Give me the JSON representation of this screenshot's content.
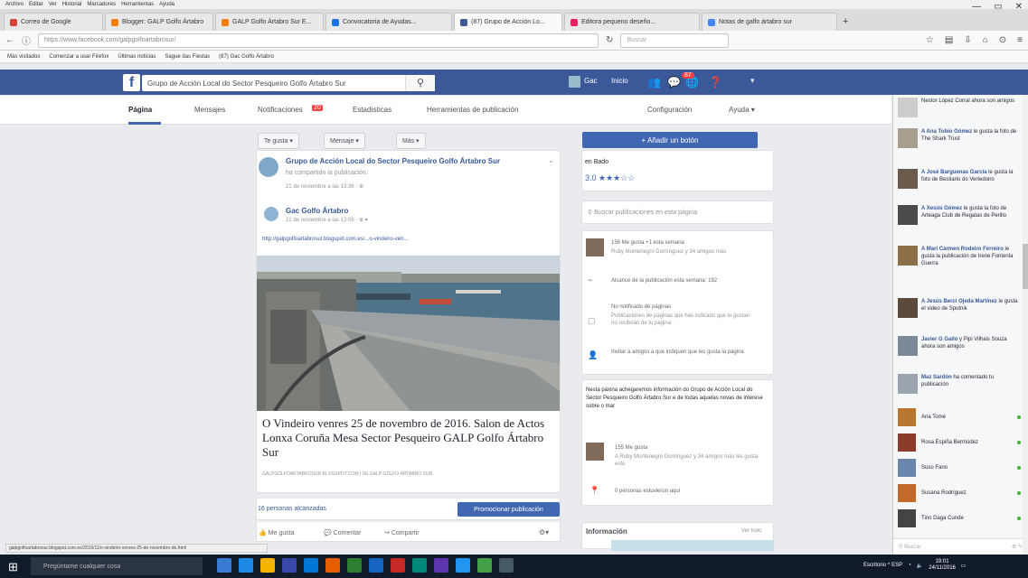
{
  "browser": {
    "menu": [
      "Archivo",
      "Editar",
      "Ver",
      "Historial",
      "Marcadores",
      "Herramientas",
      "Ayuda"
    ],
    "tabs": [
      {
        "label": "Correo de Google",
        "color": "#d44638",
        "active": false
      },
      {
        "label": "Blogger: GALP Golfo Ártabro",
        "color": "#f57d00",
        "active": false
      },
      {
        "label": "GALP Golfo Ártabro Sur E...",
        "color": "#f57d00",
        "active": false
      },
      {
        "label": "Convocatoria de Ayudas...",
        "color": "#1a73e8",
        "active": false
      },
      {
        "label": "(87) Grupo de Acción Lo...",
        "color": "#3b5998",
        "active": true
      },
      {
        "label": "Editora pequeno deseño...",
        "color": "#e91e63",
        "active": false
      },
      {
        "label": "Notas de galfo ártabro sur",
        "color": "#4285f4",
        "active": false
      }
    ],
    "url": "https://www.facebook.com/galpgolfoartabrosur/",
    "search_placeholder": "Buscar",
    "bookmarks": [
      "Más visitados",
      "Comenzar a usar Firefox",
      "Últimas noticias",
      "Sague das Fiestas",
      "(87) Gac Golfo Ártabro"
    ],
    "window_controls": [
      "—",
      "▭",
      "✕"
    ]
  },
  "facebook": {
    "logo": "f",
    "search_value": "Grupo de Acción Local do Sector Pesqueiro Golfo Ártabro Sur",
    "user_name": "Gac",
    "nav_home": "Inicio",
    "notification_count": "87",
    "page_tabs": [
      {
        "label": "Página",
        "active": true
      },
      {
        "label": "Mensajes",
        "active": false
      },
      {
        "label": "Notificaciones",
        "active": false
      },
      {
        "label": "Estadísticas",
        "active": false
      },
      {
        "label": "Herramientas de publicación",
        "active": false
      }
    ],
    "notifications_badge": "20",
    "settings_label": "Configuración",
    "help_label": "Ayuda ▾",
    "action_buttons": [
      "Te gusta ▾",
      "Mensaje ▾",
      "Más ▾"
    ],
    "add_button_label": "+ Añadir un botón"
  },
  "post": {
    "page_name": "Grupo de Acción Local do Sector Pesqueiro Golfo Ártabro Sur",
    "shared_text": "ha compartido la publicación.",
    "shared_time": "21 de noviembre a las 13:36 · ⊕",
    "inner_author": "Gac Golfo Ártabro",
    "inner_time": "21 de noviembre a las 13:08 · ⊕ ▾",
    "link_text": "http://galpgolfoartabrosur.blogspot.com.es/...o-vindeiro-ven...",
    "link_title": "O Vindeiro venres 25 de novembro de 2016. Salon de Actos Lonxa Coruña Mesa Sector Pesqueiro GALP Golfo Ártabro Sur",
    "link_domain": "GALPGOLFOARTABROSUR.BLOGSPOT.COM | DE GALP GOLFO ÁRTABRO SUR",
    "reach": "16 personas alcanzadas",
    "promote_label": "Promocionar publicación",
    "like_label": "Me gusta",
    "comment_label": "Comentar",
    "share_label": "Compartir"
  },
  "right": {
    "rating_label": "en Bado",
    "rating_value": "3.0 ★★★☆☆",
    "page_search_placeholder": "Buscar publicaciones en esta página",
    "likes_text": "156 Me gusta +1 esta semana",
    "likes_sub": "Ruby Montenegro Domínguez y 34 amigos más",
    "post_reach_line": "Alcance de la publicación esta semana: 192",
    "unread_title": "No notificado de páginas",
    "unread_sub": "Publicaciones de páginas que has indicado que te gustan no recibirán de tu página",
    "invite_text": "Invitar a amigos a que indiquen que les gusta la página",
    "about_text": "Nesta páxina achegaremos información do Grupo de Acción Local do Sector Pesqueiro Golfo Ártabro Sur e de todas aquelas novas de interese sobre o mar",
    "about_likes": "155 Me gusta",
    "about_likes_sub": "A Ruby Montenegro Domínguez y 34 amigos más les gusta esto",
    "visitors": "0 personas estuvieron aquí",
    "info_label": "Información",
    "info_link": "Ver todo"
  },
  "ticker": [
    {
      "name": "",
      "text": "Nestor López Corral ahora son amigos"
    },
    {
      "name": "A Ana Tobío Gómez",
      "text": "le gusta la foto de The Shark Trust"
    },
    {
      "name": "A José Barguenas García",
      "text": "le gusta la foto de Bestiario do Vertedoiro"
    },
    {
      "name": "A Xesús Gómez",
      "text": "le gusta la foto de Arteaga Club de Regatas de Perillo"
    },
    {
      "name": "A Mari Carmen Rodeiro Ferreiro",
      "text": "le gusta la publicación de Irene Fontenla Guerra"
    },
    {
      "name": "A Jesús Berci Ojeda Martínez",
      "text": "le gusta el video de Sputnik"
    },
    {
      "name": "Javier G Gallo",
      "text": "y Pipi Vilhais Souza ahora son amigos"
    },
    {
      "name": "Maz Sardón",
      "text": "ha comentado tu publicación"
    }
  ],
  "contacts": [
    "Ana Tomé",
    "Rosa Espiña Bermúdez",
    "Suso Fano",
    "Susana Rodríguez",
    "Tino Daga Cunde"
  ],
  "chat_search": "Buscar",
  "status_url": "galpgolfoartabrosur.blogspot.com.es/2016/11/o-vindeiro-venres-25-de-novembro-de.html",
  "taskbar": {
    "search_placeholder": "Pregúntame cualquier cosa",
    "tray_text": "Escritorio  ^  ESP",
    "clock_time": "19:01",
    "clock_date": "24/11/2016"
  }
}
